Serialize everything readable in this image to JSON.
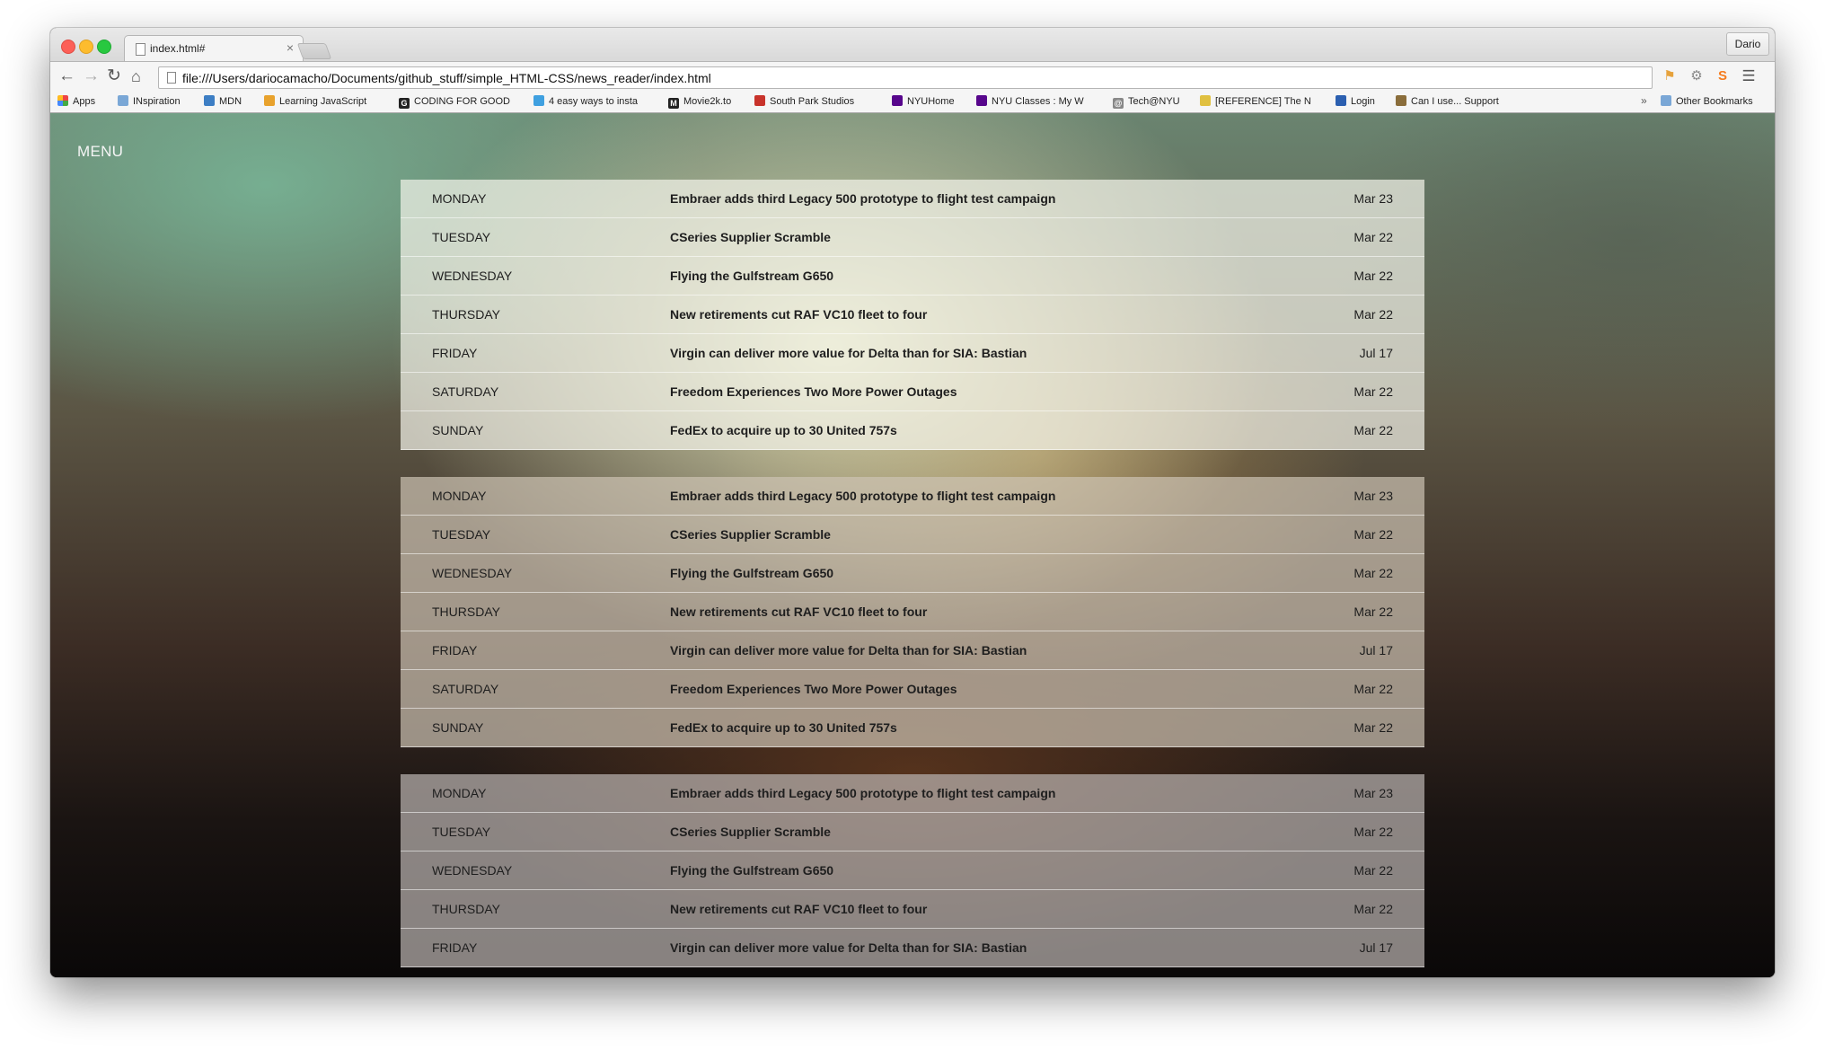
{
  "browser": {
    "tab_title": "index.html#",
    "tab_close": "×",
    "profile_name": "Dario",
    "url": "file:///Users/dariocamacho/Documents/github_stuff/simple_HTML-CSS/news_reader/index.html",
    "nav": {
      "back": "←",
      "forward": "→",
      "reload": "↻",
      "home": "⌂"
    },
    "bookmarks": [
      {
        "label": "Apps",
        "icon": "apps-grid-icon"
      },
      {
        "label": "INspiration",
        "icon": "folder-icon"
      },
      {
        "label": "MDN",
        "icon": "mdn-icon"
      },
      {
        "label": "Learning JavaScript",
        "icon": "bookmark-icon"
      },
      {
        "label": "CODING FOR GOOD",
        "icon": "coding-icon"
      },
      {
        "label": "4 easy ways to insta",
        "icon": "bookmark-icon"
      },
      {
        "label": "Movie2k.to",
        "icon": "m-icon"
      },
      {
        "label": "South Park Studios",
        "icon": "southpark-icon"
      },
      {
        "label": "NYUHome",
        "icon": "nyu-icon"
      },
      {
        "label": "NYU Classes : My W",
        "icon": "nyu-icon"
      },
      {
        "label": "Tech@NYU",
        "icon": "at-icon"
      },
      {
        "label": "[REFERENCE] The N",
        "icon": "bookmark-icon"
      },
      {
        "label": "Login",
        "icon": "login-icon"
      },
      {
        "label": "Can I use... Support",
        "icon": "bookmark-icon"
      }
    ],
    "bookmarks_overflow": "»",
    "other_bookmarks": "Other Bookmarks"
  },
  "page": {
    "menu_label": "MENU",
    "groups": [
      [
        {
          "day": "MONDAY",
          "headline": "Embraer adds third Legacy 500 prototype to flight test campaign",
          "date": "Mar 23"
        },
        {
          "day": "TUESDAY",
          "headline": "CSeries Supplier Scramble",
          "date": "Mar 22"
        },
        {
          "day": "WEDNESDAY",
          "headline": "Flying the Gulfstream G650",
          "date": "Mar 22"
        },
        {
          "day": "THURSDAY",
          "headline": "New retirements cut RAF VC10 fleet to four",
          "date": "Mar 22"
        },
        {
          "day": "FRIDAY",
          "headline": "Virgin can deliver more value for Delta than for SIA: Bastian",
          "date": "Jul 17"
        },
        {
          "day": "SATURDAY",
          "headline": "Freedom Experiences Two More Power Outages",
          "date": "Mar 22"
        },
        {
          "day": "SUNDAY",
          "headline": "FedEx to acquire up to 30 United 757s",
          "date": "Mar 22"
        }
      ],
      [
        {
          "day": "MONDAY",
          "headline": "Embraer adds third Legacy 500 prototype to flight test campaign",
          "date": "Mar 23"
        },
        {
          "day": "TUESDAY",
          "headline": "CSeries Supplier Scramble",
          "date": "Mar 22"
        },
        {
          "day": "WEDNESDAY",
          "headline": "Flying the Gulfstream G650",
          "date": "Mar 22"
        },
        {
          "day": "THURSDAY",
          "headline": "New retirements cut RAF VC10 fleet to four",
          "date": "Mar 22"
        },
        {
          "day": "FRIDAY",
          "headline": "Virgin can deliver more value for Delta than for SIA: Bastian",
          "date": "Jul 17"
        },
        {
          "day": "SATURDAY",
          "headline": "Freedom Experiences Two More Power Outages",
          "date": "Mar 22"
        },
        {
          "day": "SUNDAY",
          "headline": "FedEx to acquire up to 30 United 757s",
          "date": "Mar 22"
        }
      ],
      [
        {
          "day": "MONDAY",
          "headline": "Embraer adds third Legacy 500 prototype to flight test campaign",
          "date": "Mar 23"
        },
        {
          "day": "TUESDAY",
          "headline": "CSeries Supplier Scramble",
          "date": "Mar 22"
        },
        {
          "day": "WEDNESDAY",
          "headline": "Flying the Gulfstream G650",
          "date": "Mar 22"
        },
        {
          "day": "THURSDAY",
          "headline": "New retirements cut RAF VC10 fleet to four",
          "date": "Mar 22"
        },
        {
          "day": "FRIDAY",
          "headline": "Virgin can deliver more value for Delta than for SIA: Bastian",
          "date": "Jul 17"
        }
      ]
    ]
  }
}
